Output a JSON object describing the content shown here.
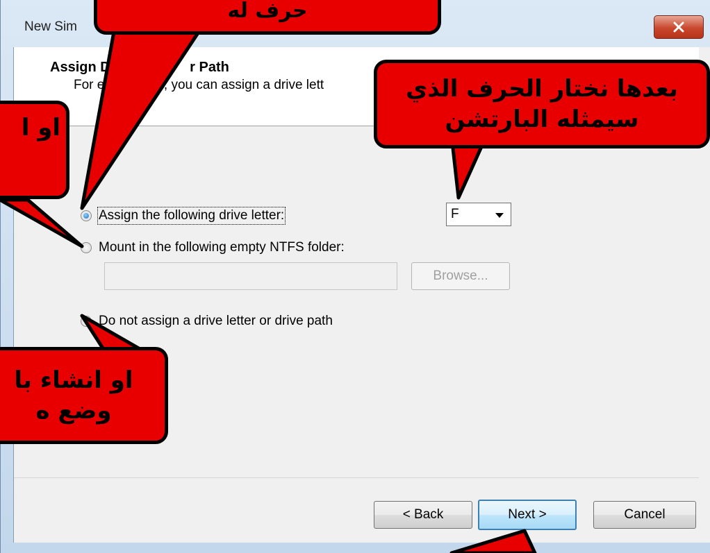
{
  "window": {
    "title": "New Sim"
  },
  "header": {
    "title_part1": "Assign Driv",
    "title_part2": "r Path",
    "subtitle_part1": "For easi",
    "subtitle_part2": "r, you can assign a drive lett"
  },
  "options": {
    "assign_letter": "Assign the following drive letter:",
    "mount_folder": "Mount in the following empty NTFS folder:",
    "no_assign": "Do not assign a drive letter or drive path",
    "selected": "assign_letter"
  },
  "drive_letter": {
    "value": "F"
  },
  "folder_path": {
    "value": "",
    "browse_label": "Browse..."
  },
  "buttons": {
    "back": "< Back",
    "next": "Next >",
    "cancel": "Cancel"
  },
  "annotations": {
    "top_callout": "حرف له",
    "right_callout": "بعدها نختار الحرف الذي سيمثله البارتشن",
    "left_callout": "او ا",
    "bottom_callout": "او انشاء با وضع ه"
  },
  "colors": {
    "callout_fill": "#e80000",
    "callout_border": "#000000",
    "close_button": "#c9482d"
  }
}
